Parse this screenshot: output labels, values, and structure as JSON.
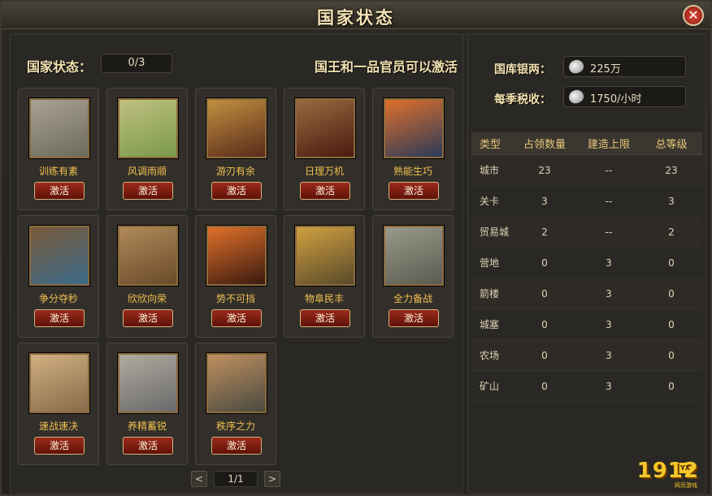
{
  "window": {
    "title": "国家状态",
    "close": "✕"
  },
  "status": {
    "label": "国家状态：",
    "value": "0/3",
    "hint": "国王和一品官员可以激活"
  },
  "cards": [
    {
      "name": "训练有素",
      "button": "激活",
      "colors": [
        "#6e6a5a",
        "#a8a294"
      ]
    },
    {
      "name": "风调雨顺",
      "button": "激活",
      "colors": [
        "#7a9a4a",
        "#c0c080"
      ]
    },
    {
      "name": "游刃有余",
      "button": "激活",
      "colors": [
        "#5a2a1a",
        "#c09040"
      ]
    },
    {
      "name": "日理万机",
      "button": "激活",
      "colors": [
        "#4a1a10",
        "#9a6a40"
      ]
    },
    {
      "name": "熟能生巧",
      "button": "激活",
      "colors": [
        "#2a3a5a",
        "#e0702a"
      ]
    },
    {
      "name": "争分夺秒",
      "button": "激活",
      "colors": [
        "#3a6a8a",
        "#7a5a3a"
      ]
    },
    {
      "name": "欣欣向荣",
      "button": "激活",
      "colors": [
        "#6a4a2a",
        "#b08a5a"
      ]
    },
    {
      "name": "势不可挡",
      "button": "激活",
      "colors": [
        "#3a1a10",
        "#e0702a"
      ]
    },
    {
      "name": "物阜民丰",
      "button": "激活",
      "colors": [
        "#5a4a2a",
        "#d0a040"
      ]
    },
    {
      "name": "全力备战",
      "button": "激活",
      "colors": [
        "#5a5a50",
        "#9a9a8a"
      ]
    },
    {
      "name": "速战速决",
      "button": "激活",
      "colors": [
        "#8a6a4a",
        "#d0b080"
      ]
    },
    {
      "name": "养精蓄锐",
      "button": "激活",
      "colors": [
        "#6a6a6a",
        "#b0aaa0"
      ]
    },
    {
      "name": "秩序之力",
      "button": "激活",
      "colors": [
        "#4a4a40",
        "#c09060"
      ]
    }
  ],
  "pager": {
    "prev": "<",
    "page": "1/1",
    "next": ">"
  },
  "treasury": {
    "label": "国库银两：",
    "value": "225万"
  },
  "tax": {
    "label": "每季税收：",
    "value": "1750/小时"
  },
  "table": {
    "headers": [
      "类型",
      "占领数量",
      "建造上限",
      "总等级"
    ],
    "rows": [
      [
        "城市",
        "23",
        "--",
        "23"
      ],
      [
        "关卡",
        "3",
        "--",
        "3"
      ],
      [
        "贸易城",
        "2",
        "--",
        "2"
      ],
      [
        "营地",
        "0",
        "3",
        "0"
      ],
      [
        "箭楼",
        "0",
        "3",
        "0"
      ],
      [
        "城塞",
        "0",
        "3",
        "0"
      ],
      [
        "农场",
        "0",
        "3",
        "0"
      ],
      [
        "矿山",
        "0",
        "3",
        "0"
      ]
    ]
  },
  "logo": {
    "main": "1912",
    "badge": "YX",
    "sub": "网页游戏"
  }
}
